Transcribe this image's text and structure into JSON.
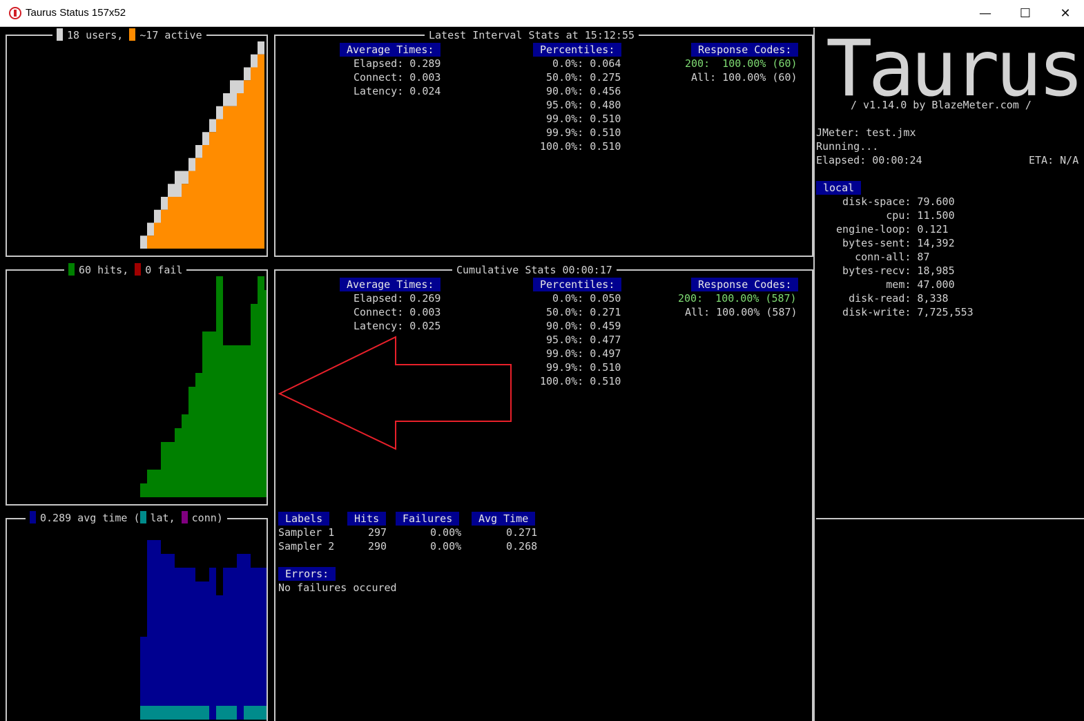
{
  "window": {
    "title": "Taurus Status 157x52",
    "minimize": "—",
    "maximize": "☐",
    "close": "✕"
  },
  "users_panel": {
    "users": "18 users,",
    "active": "~17 active",
    "users_color": "#d3d3d3",
    "active_color": "#ff8c00"
  },
  "hits_panel": {
    "hits": "60 hits,",
    "fail": "0 fail",
    "hits_color": "#008000",
    "fail_color": "#a00000"
  },
  "time_panel": {
    "avg": "0.289 avg time",
    "open": "(",
    "lat": "lat,",
    "conn": "conn)",
    "avg_color": "#000090",
    "lat_color": "#008b8b",
    "conn_color": "#800080"
  },
  "latest": {
    "title": "Latest Interval Stats at 15:12:55",
    "avg_header": "Average Times:",
    "avg": [
      "Elapsed: 0.289",
      "Connect: 0.003",
      "Latency: 0.024"
    ],
    "pct_header": "Percentiles:",
    "pct": [
      "  0.0%: 0.064",
      " 50.0%: 0.275",
      " 90.0%: 0.456",
      " 95.0%: 0.480",
      " 99.0%: 0.510",
      " 99.9%: 0.510",
      "100.0%: 0.510"
    ],
    "rc_header": "Response Codes:",
    "rc": [
      {
        "label": "200:  100.00% (60)",
        "green": true
      },
      {
        "label": "All: 100.00% (60)",
        "green": false
      }
    ]
  },
  "cumulative": {
    "title": "Cumulative Stats 00:00:17",
    "avg_header": "Average Times:",
    "avg": [
      "Elapsed: 0.269",
      "Connect: 0.003",
      "Latency: 0.025"
    ],
    "pct_header": "Percentiles:",
    "pct": [
      "  0.0%: 0.050",
      " 50.0%: 0.271",
      " 90.0%: 0.459",
      " 95.0%: 0.477",
      " 99.0%: 0.497",
      " 99.9%: 0.510",
      "100.0%: 0.510"
    ],
    "rc_header": "Response Codes:",
    "rc": [
      {
        "label": "200:  100.00% (587)",
        "green": true
      },
      {
        "label": "All: 100.00% (587)",
        "green": false
      }
    ]
  },
  "labels_table": {
    "headers": [
      "Labels",
      "Hits",
      "Failures",
      "Avg Time"
    ],
    "rows": [
      [
        "Sampler 1",
        "297",
        "0.00%",
        "0.271"
      ],
      [
        "Sampler 2",
        "290",
        "0.00%",
        "0.268"
      ]
    ],
    "errors_header": "Errors:",
    "errors_text": "No failures occured"
  },
  "side": {
    "logo": "Taurus",
    "version": "/ v1.14.0 by BlazeMeter.com /",
    "jmeter": "JMeter: test.jmx",
    "status": "Running...",
    "elapsed": "Elapsed: 00:00:24",
    "eta": "ETA: N/A",
    "local_header": "local",
    "metrics": [
      "  disk-space: 79.600",
      "         cpu: 11.500",
      " engine-loop: 0.121",
      "  bytes-sent: 14,392",
      "    conn-all: 87",
      "  bytes-recv: 18,985",
      "         mem: 47.000",
      "   disk-read: 8,338",
      "  disk-write: 7,725,553"
    ]
  },
  "chart_data": [
    {
      "type": "area",
      "title": "18 users, ~17 active",
      "series": [
        {
          "name": "users",
          "values": [
            1,
            2,
            3,
            4,
            5,
            6,
            6,
            7,
            8,
            9,
            10,
            11,
            12,
            13,
            13,
            14,
            15,
            16
          ]
        },
        {
          "name": "active",
          "values": [
            0,
            1,
            2,
            3,
            4,
            4,
            5,
            6,
            7,
            8,
            9,
            10,
            11,
            11,
            12,
            13,
            14,
            15
          ]
        }
      ],
      "ylim": [
        0,
        16
      ]
    },
    {
      "type": "area",
      "title": "60 hits, 0 fail",
      "series": [
        {
          "name": "hits",
          "values": [
            1,
            2,
            2,
            4,
            4,
            5,
            6,
            8,
            9,
            12,
            12,
            16,
            11,
            11,
            11,
            11,
            14,
            16,
            15,
            16
          ]
        },
        {
          "name": "fail",
          "values": [
            0,
            0,
            0,
            0,
            0,
            0,
            0,
            0,
            0,
            0,
            0,
            0,
            0,
            0,
            0,
            0,
            0,
            0,
            0,
            0
          ]
        }
      ],
      "ylim": [
        0,
        16
      ]
    },
    {
      "type": "area",
      "title": "0.289 avg time (lat, conn)",
      "series": [
        {
          "name": "avg time",
          "values": [
            6,
            13,
            13,
            12,
            12,
            11,
            11,
            11,
            10,
            10,
            11,
            9,
            11,
            11,
            12,
            12,
            11,
            11,
            11,
            12
          ]
        },
        {
          "name": "lat",
          "values": [
            1,
            1,
            1,
            1,
            1,
            1,
            1,
            1,
            1,
            1,
            0,
            1,
            1,
            1,
            0,
            1,
            1,
            1,
            1,
            0
          ]
        },
        {
          "name": "conn",
          "values": [
            0,
            0,
            0,
            0,
            0,
            0,
            0,
            0,
            0,
            0,
            0,
            0,
            0,
            0,
            0,
            0,
            0,
            0,
            0,
            0
          ]
        }
      ],
      "ylim": [
        0,
        13
      ]
    }
  ]
}
